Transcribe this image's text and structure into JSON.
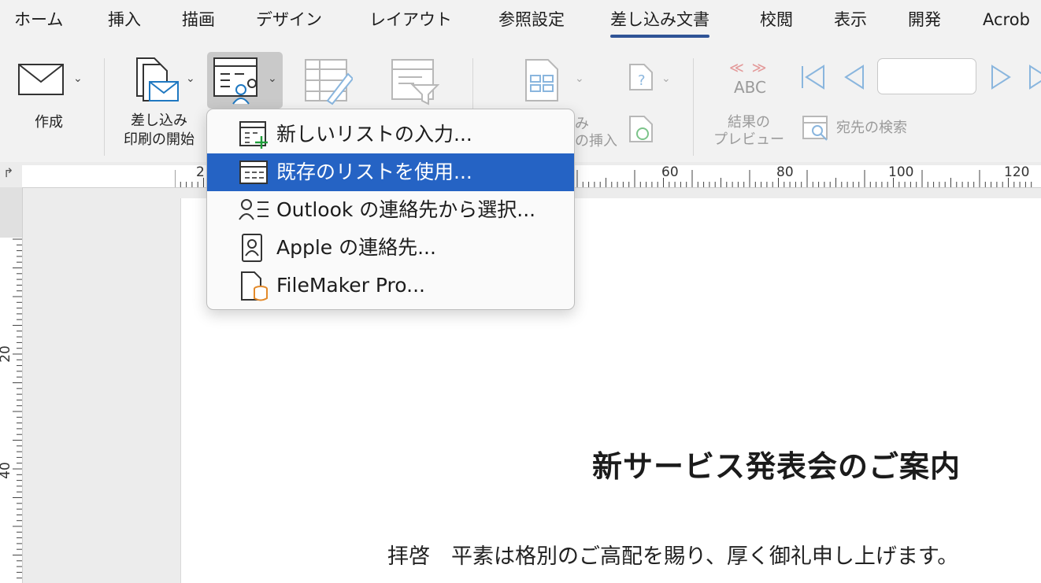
{
  "tabs": [
    {
      "label": "ホーム",
      "active": false
    },
    {
      "label": "挿入",
      "active": false
    },
    {
      "label": "描画",
      "active": false
    },
    {
      "label": "デザイン",
      "active": false
    },
    {
      "label": "レイアウト",
      "active": false
    },
    {
      "label": "参照設定",
      "active": false
    },
    {
      "label": "差し込み文書",
      "active": true
    },
    {
      "label": "校閲",
      "active": false
    },
    {
      "label": "表示",
      "active": false
    },
    {
      "label": "開発",
      "active": false
    },
    {
      "label": "Acrob",
      "active": false
    }
  ],
  "ribbon": {
    "create_label": "作成",
    "start_merge_label_line1": "差し込み",
    "start_merge_label_line2": "印刷の開始",
    "insert_partial_line1": "み",
    "insert_partial_line2": "の挿入",
    "preview_line1": "結果の",
    "preview_line2": "プレビュー",
    "find_recipient_label": "宛先の検索",
    "abc_label": "ABC",
    "record_value": ""
  },
  "menu": {
    "items": [
      {
        "label": "新しいリストの入力...",
        "icon": "new-list-icon",
        "highlighted": false
      },
      {
        "label": "既存のリストを使用...",
        "icon": "existing-list-icon",
        "highlighted": true
      },
      {
        "label": "Outlook の連絡先から選択...",
        "icon": "outlook-contacts-icon",
        "highlighted": false
      },
      {
        "label": "Apple の連絡先...",
        "icon": "apple-contacts-icon",
        "highlighted": false
      },
      {
        "label": "FileMaker Pro...",
        "icon": "filemaker-icon",
        "highlighted": false
      }
    ]
  },
  "ruler": {
    "h_labels": [
      "2",
      "60",
      "80",
      "100",
      "120"
    ],
    "v_labels": [
      "20",
      "40"
    ]
  },
  "document": {
    "title": "新サービス発表会のご案内",
    "body": "拝啓　平素は格別のご高配を賜り、厚く御礼申し上げます。"
  },
  "colors": {
    "accent": "#2f5496",
    "menu_highlight": "#2563c4"
  }
}
